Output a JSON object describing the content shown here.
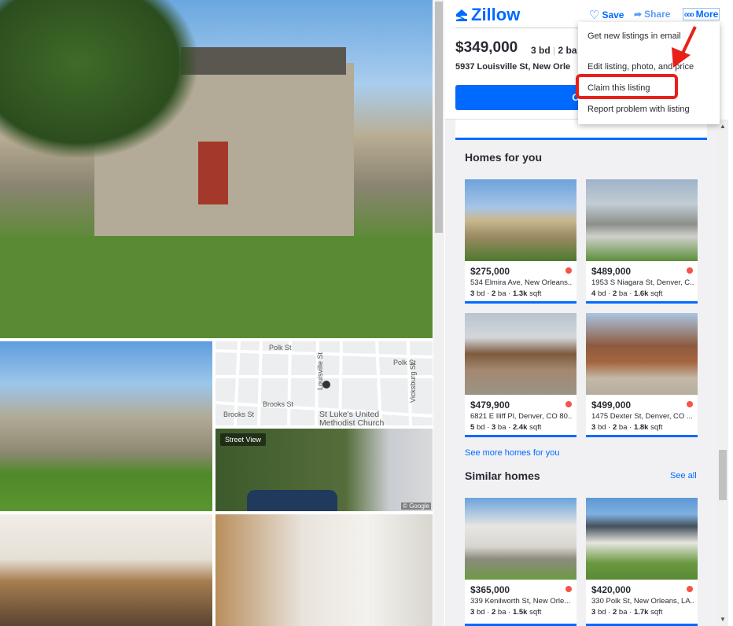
{
  "listing": {
    "price": "$349,000",
    "beds": "3 bd",
    "baths": "2 ba",
    "address": "5937 Louisville St, New Orle",
    "contact_label": "Con"
  },
  "header": {
    "logo": "Zillow",
    "save": "Save",
    "share": "Share",
    "more": "More"
  },
  "menu": {
    "items": [
      "Get new listings in email",
      "Edit listing, photo, and price",
      "Claim this listing",
      "Report problem with listing"
    ],
    "highlighted": "Claim this listing"
  },
  "map": {
    "labels": [
      "Polk St",
      "Polk St",
      "Louisville St",
      "Vicksburg St",
      "Brooks St",
      "Brooks St",
      "St Luke's United Methodist Church"
    ],
    "street_view": "Street View",
    "copyright": "© Google"
  },
  "homes_for_you": {
    "title": "Homes for you",
    "see_more": "See more homes for you",
    "cards": [
      {
        "price": "$275,000",
        "address": "534 Elmira Ave, New Orleans...",
        "bd": "3",
        "ba": "2",
        "sqft": "1.3k"
      },
      {
        "price": "$489,000",
        "address": "1953 S Niagara St, Denver, C...",
        "bd": "4",
        "ba": "2",
        "sqft": "1.6k"
      },
      {
        "price": "$479,900",
        "address": "6821 E Iliff Pl, Denver, CO 80...",
        "bd": "5",
        "ba": "3",
        "sqft": "2.4k"
      },
      {
        "price": "$499,000",
        "address": "1475 Dexter St, Denver, CO ...",
        "bd": "3",
        "ba": "2",
        "sqft": "1.8k"
      }
    ]
  },
  "similar_homes": {
    "title": "Similar homes",
    "see_all": "See all",
    "cards": [
      {
        "price": "$365,000",
        "address": "339 Kenilworth St, New Orle...",
        "bd": "3",
        "ba": "2",
        "sqft": "1.5k"
      },
      {
        "price": "$420,000",
        "address": "330 Polk St, New Orleans, LA...",
        "bd": "3",
        "ba": "2",
        "sqft": "1.7k"
      }
    ]
  },
  "units": {
    "bd": "bd",
    "ba": "ba",
    "sqft": "sqft"
  },
  "colors": {
    "brand": "#006aff",
    "alert_red": "#e8201a",
    "dot": "#f4544b"
  }
}
